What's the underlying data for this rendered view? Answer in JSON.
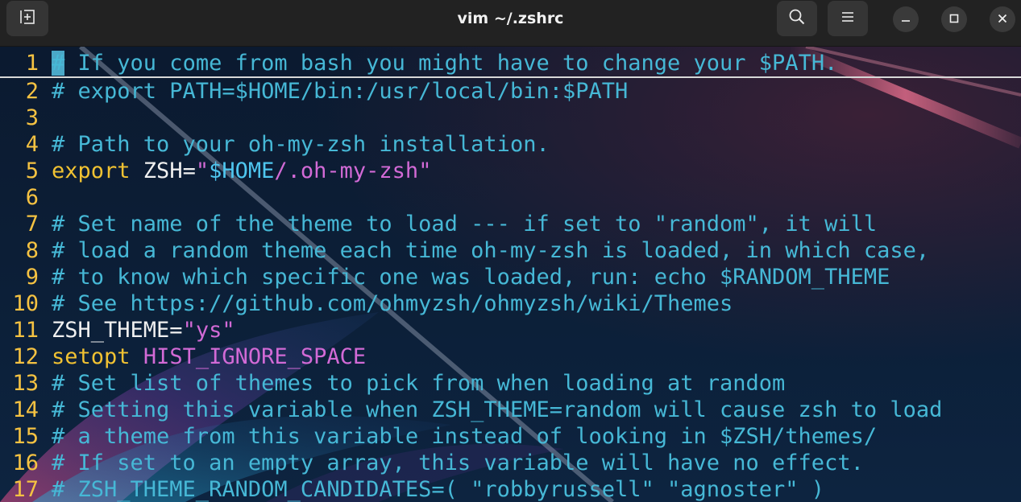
{
  "window": {
    "title": "vim ~/.zshrc",
    "icons": {
      "new_tab": "new-tab-icon",
      "search": "search-icon",
      "menu": "hamburger-menu-icon",
      "minimize": "minimize-icon",
      "maximize": "maximize-icon",
      "close": "close-icon"
    }
  },
  "colors": {
    "line_number": "#f5c242",
    "comment": "#46b8d6",
    "keyword": "#f1c232",
    "string": "#d26ad6",
    "variable": "#4fc6ef",
    "text": "#f0f0f0"
  },
  "editor": {
    "lines": [
      {
        "num": "1",
        "cursor": "#",
        "text": " If you come from bash you might have to change your $PATH."
      },
      {
        "num": "2",
        "text": "# export PATH=$HOME/bin:/usr/local/bin:$PATH"
      },
      {
        "num": "3",
        "text": ""
      },
      {
        "num": "4",
        "text": "# Path to your oh-my-zsh installation."
      },
      {
        "num": "5",
        "kw": "export",
        "plain1": " ZSH=",
        "q1": "\"",
        "var": "$HOME",
        "str": "/.oh-my-zsh",
        "q2": "\""
      },
      {
        "num": "6",
        "text": ""
      },
      {
        "num": "7",
        "text": "# Set name of the theme to load --- if set to \"random\", it will"
      },
      {
        "num": "8",
        "text": "# load a random theme each time oh-my-zsh is loaded, in which case,"
      },
      {
        "num": "9",
        "text": "# to know which specific one was loaded, run: echo $RANDOM_THEME"
      },
      {
        "num": "10",
        "text": "# See https://github.com/ohmyzsh/ohmyzsh/wiki/Themes"
      },
      {
        "num": "11",
        "plain1": "ZSH_THEME=",
        "str": "\"ys\""
      },
      {
        "num": "12",
        "kw": "setopt",
        "plain1": " ",
        "str": "HIST_IGNORE_SPACE"
      },
      {
        "num": "13",
        "text": "# Set list of themes to pick from when loading at random"
      },
      {
        "num": "14",
        "text": "# Setting this variable when ZSH_THEME=random will cause zsh to load"
      },
      {
        "num": "15",
        "text": "# a theme from this variable instead of looking in $ZSH/themes/"
      },
      {
        "num": "16",
        "text": "# If set to an empty array, this variable will have no effect."
      },
      {
        "num": "17",
        "text": "# ZSH_THEME_RANDOM_CANDIDATES=( \"robbyrussell\" \"agnoster\" )"
      }
    ]
  }
}
